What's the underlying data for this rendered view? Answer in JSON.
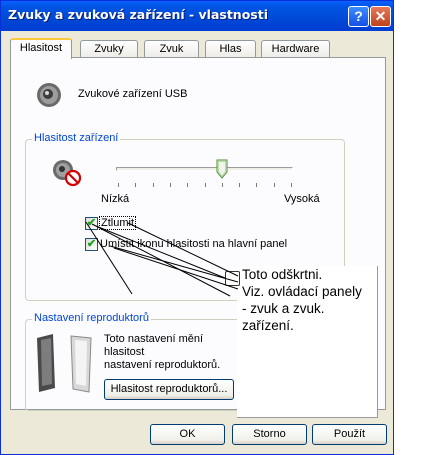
{
  "window": {
    "title": "Zvuky a zvuková zařízení - vlastnosti",
    "help_button": "?",
    "close_button": "✕"
  },
  "tabs": [
    "Hlasitost",
    "Zvuky",
    "Zvuk",
    "Hlas",
    "Hardware"
  ],
  "active_tab": "Hlasitost",
  "device": {
    "icon": "speaker-icon",
    "name": "Zvukové zařízení USB"
  },
  "volume_group": {
    "label": "Hlasitost zařízení",
    "icon": "muted-speaker-icon",
    "slider_level": 0.6,
    "low_label": "Nízká",
    "high_label": "Vysoká",
    "mute_label": "Ztlumit",
    "mute_checked": true,
    "tray_icon_label": "Umístit ikonu hlasitosti na hlavní panel",
    "tray_icon_checked": true
  },
  "speakers_group": {
    "label": "Nastavení reproduktorů",
    "icon": "speakers-icon",
    "description": "Toto nastavení mění hlasitost\nnastavení reproduktorů.",
    "volume_button": "Hlasitost reproduktorů..."
  },
  "buttons": {
    "ok": "OK",
    "cancel": "Storno",
    "apply": "Použít"
  },
  "annotation": {
    "text": "Toto odškrtni.\nViz. ovládací panely\n- zvuk a zvuk.\nzařízení."
  }
}
